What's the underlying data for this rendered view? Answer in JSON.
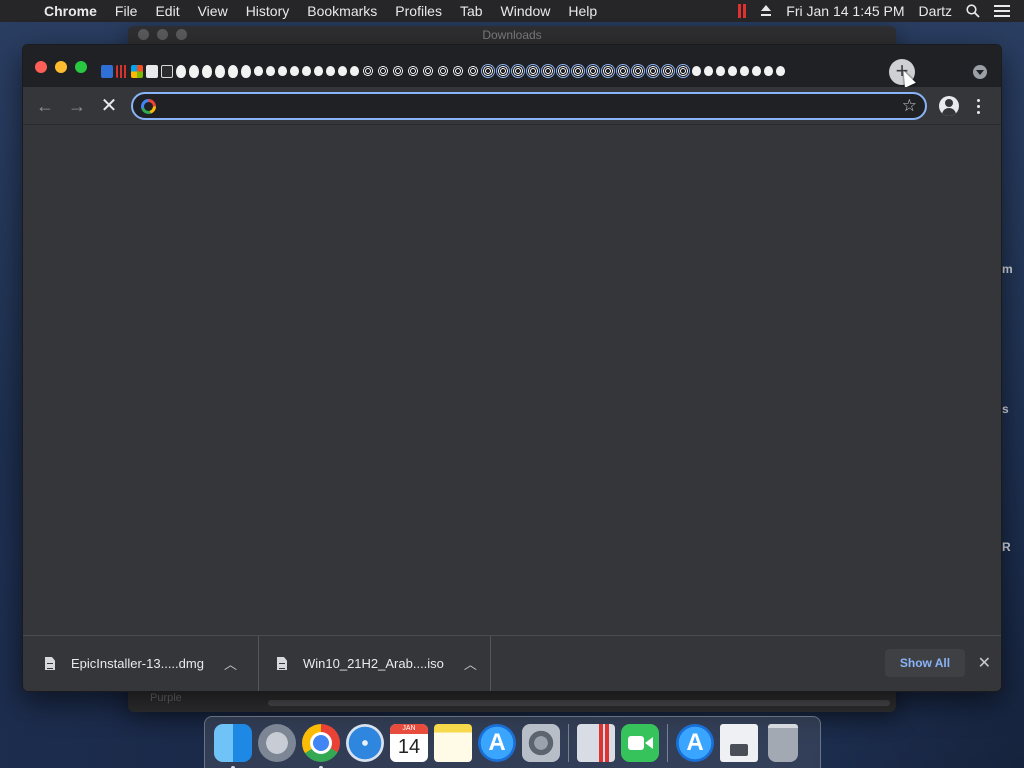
{
  "menubar": {
    "app_name": "Chrome",
    "items": [
      "File",
      "Edit",
      "View",
      "History",
      "Bookmarks",
      "Profiles",
      "Tab",
      "Window",
      "Help"
    ],
    "clock": "Fri Jan 14  1:45 PM",
    "user": "Dartz"
  },
  "background_window": {
    "title": "Downloads",
    "sidebar_text": "Purple"
  },
  "desktop_slivers": [
    "m",
    "s",
    "R"
  ],
  "browser": {
    "new_tab_symbol": "+",
    "omnibox": {
      "value": "",
      "placeholder": ""
    },
    "nav": {
      "back": "←",
      "forward": "→",
      "stop": "✕"
    }
  },
  "downloads": {
    "items": [
      {
        "filename": "EpicInstaller-13.....dmg"
      },
      {
        "filename": "Win10_21H2_Arab....iso"
      }
    ],
    "show_all_label": "Show All",
    "close_symbol": "✕"
  },
  "dock": {
    "calendar_month": "JAN",
    "calendar_day": "14",
    "apps": [
      "finder",
      "launchpad",
      "chrome",
      "safari",
      "calendar",
      "notes",
      "app-store",
      "system-preferences",
      "parallels",
      "facetime",
      "app-store",
      "document",
      "trash"
    ]
  },
  "colors": {
    "accent": "#8ab4f8",
    "tabstrip": "#202124",
    "toolbar": "#35363a",
    "menubar": "#262628"
  }
}
